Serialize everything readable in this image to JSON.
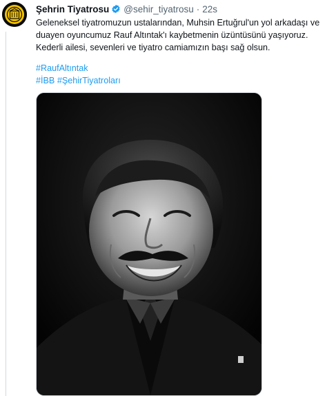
{
  "tweet": {
    "author_name": "Şehrin Tiyatrosu",
    "handle": "@sehir_tiyatrosu",
    "separator": "·",
    "timestamp": "22s",
    "text_lines": [
      "Geleneksel tiyatromuzun ustalarından, Muhsin Ertuğrul'un yol arkadaşı ve",
      "duayen oyuncumuz Rauf Altıntak'ı kaybetmenin üzüntüsünü yaşıyoruz.",
      "Kederli ailesi, sevenleri ve tiyatro camiamızın başı sağ olsun."
    ],
    "hashtags": {
      "line1": [
        "#RaufAltıntak"
      ],
      "line2": [
        "#İBB",
        "#ŞehirTiyatroları"
      ]
    }
  },
  "colors": {
    "link": "#1d9bf0",
    "verified": "#1d9bf0",
    "secondary_text": "#536471",
    "avatar_badge": "#f5c400"
  },
  "icons": {
    "verified": "verified-badge-icon",
    "avatar": "sehir-tiyatrolari-logo"
  }
}
